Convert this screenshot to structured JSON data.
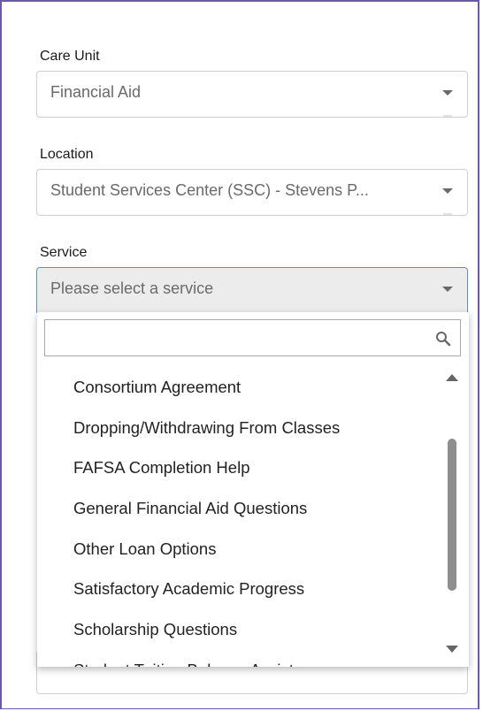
{
  "care_unit": {
    "label": "Care Unit",
    "value": "Financial Aid"
  },
  "location": {
    "label": "Location",
    "value": "Student Services Center (SSC) - Stevens P..."
  },
  "service": {
    "label": "Service",
    "placeholder": "Please select a service",
    "search_placeholder": "",
    "options": [
      "Consortium Agreement",
      "Dropping/Withdrawing From Classes",
      "FAFSA Completion Help",
      "General Financial Aid Questions",
      "Other Loan Options",
      "Satisfactory Academic Progress",
      "Scholarship Questions",
      "Student Tuition Balance Assistance"
    ]
  },
  "colors": {
    "frame_border": "#6b59a8",
    "focus_border": "#5a8fd0",
    "text": "#222222",
    "muted_text": "#6a6a6a"
  },
  "icons": {
    "search": "search-icon",
    "caret": "chevron-down-icon",
    "scroll_up": "scroll-up-arrow-icon",
    "scroll_down": "scroll-down-arrow-icon"
  }
}
